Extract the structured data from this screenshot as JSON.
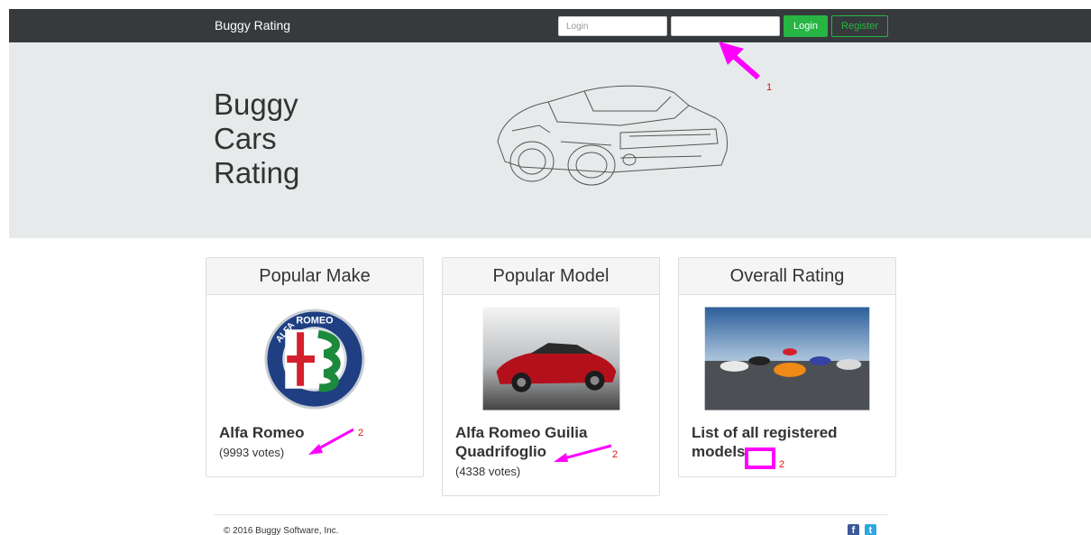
{
  "navbar": {
    "brand": "Buggy Rating",
    "login_placeholder": "Login",
    "password_value": "",
    "login_button": "Login",
    "register_button": "Register"
  },
  "hero": {
    "title_lines": [
      "Buggy",
      "Cars",
      "Rating"
    ]
  },
  "cards": [
    {
      "header": "Popular Make",
      "title": "Alfa Romeo",
      "votes": "(9993 votes)",
      "image": "alfa-romeo-logo"
    },
    {
      "header": "Popular Model",
      "title": "Alfa Romeo Guilia Quadrifoglio",
      "votes": "(4338 votes)",
      "image": "red-sports-car-photo"
    },
    {
      "header": "Overall Rating",
      "title": "List of all registered models.",
      "votes": "",
      "image": "supercars-lineup-photo"
    }
  ],
  "footer": {
    "copyright": "© 2016 Buggy Software, Inc.",
    "social": [
      "facebook-icon",
      "twitter-icon"
    ],
    "facebook_glyph": "f",
    "twitter_glyph": "t"
  },
  "annotations": {
    "marker_1": "1",
    "marker_2": "2",
    "color": "#ff00ff",
    "number_color": "#e01010"
  },
  "colors": {
    "navbar": "#363a3c",
    "hero": "#e7eaeb",
    "accent_green": "#27b543"
  }
}
